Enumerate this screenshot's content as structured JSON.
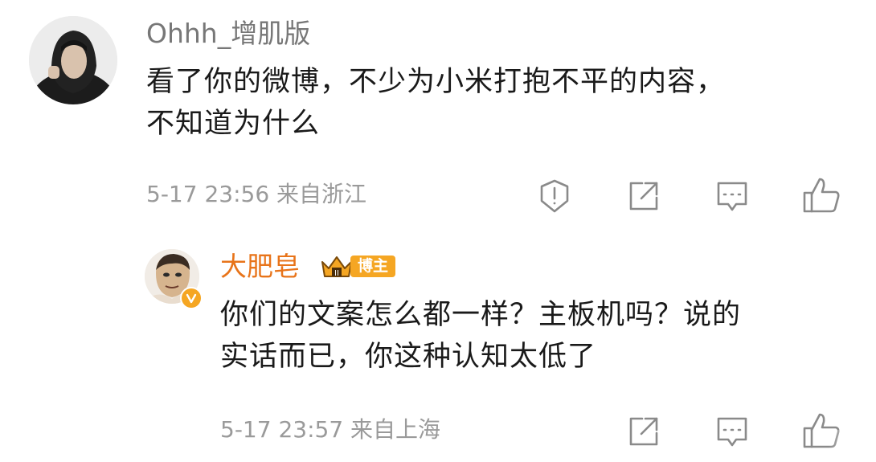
{
  "comment": {
    "username": "Ohhh_增肌版",
    "content_line1": "看了你的微博，不少为小米打抱不平的内容，",
    "content_line2": "不知道为什么",
    "meta": "5-17 23:56 来自浙江",
    "icons": [
      "report-icon",
      "share-icon",
      "reply-icon",
      "like-icon"
    ]
  },
  "reply": {
    "username": "大肥皂",
    "badge_label": "博主",
    "content_line1": "你们的文案怎么都一样？主板机吗？说的",
    "content_line2": "实话而已，你这种认知太低了",
    "meta": "5-17 23:57 来自上海",
    "icons": [
      "share-icon",
      "reply-icon",
      "like-icon"
    ]
  },
  "colors": {
    "username_reply": "#e8741a",
    "badge": "#f5a623",
    "meta": "#9a9a9a",
    "text": "#1a1a1a"
  }
}
